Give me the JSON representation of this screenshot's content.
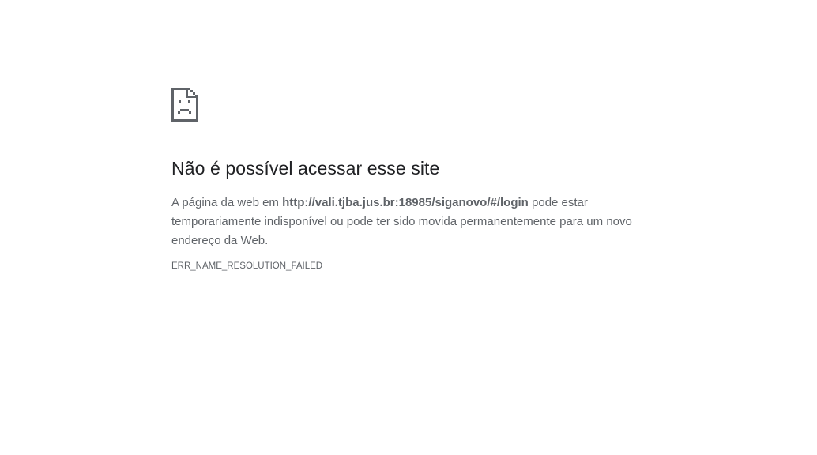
{
  "error_page": {
    "icon": "sad-page-icon",
    "title": "Não é possível acessar esse site",
    "description_prefix": "A página da web em ",
    "url": "http://vali.tjba.jus.br:18985/siganovo/#/login",
    "description_suffix": " pode estar temporariamente indisponível ou pode ter sido movida permanentemente para um novo endereço da Web.",
    "error_code": "ERR_NAME_RESOLUTION_FAILED"
  },
  "colors": {
    "background": "#ffffff",
    "title": "#202124",
    "text": "#5f6368"
  }
}
